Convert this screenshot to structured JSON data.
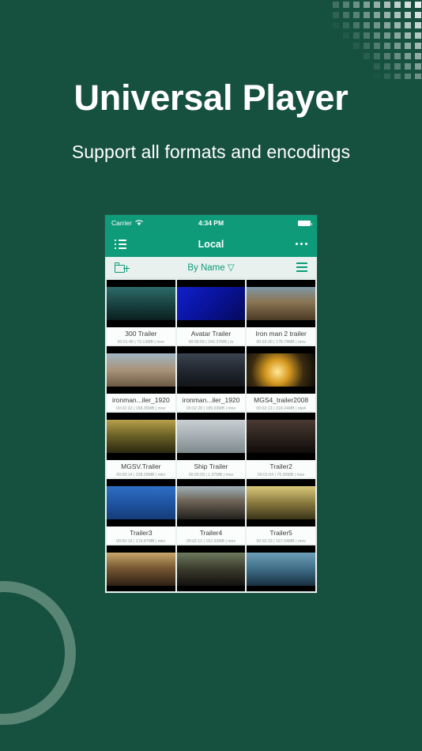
{
  "page": {
    "background_color": "#16503F",
    "accent_color": "#0D9B79",
    "ring_color": "#5D8878",
    "headline": "Universal Player",
    "subheadline": "Support all formats and encodings"
  },
  "decor": {
    "dot_grid_name": "dot-grid-decoration",
    "ring_name": "circle-outline-decoration"
  },
  "phone": {
    "status_bar": {
      "carrier": "Carrier",
      "wifi_icon": "wifi-icon",
      "time": "4:34 PM",
      "battery_icon": "battery-full-icon"
    },
    "nav_bar": {
      "left_icon": "list-view-icon",
      "title": "Local",
      "right_icon": "more-options-icon"
    },
    "toolbar": {
      "left_icon": "new-folder-icon",
      "sort_label": "By Name ▽",
      "right_icon": "hamburger-menu-icon"
    },
    "grid": {
      "items": [
        {
          "title": "300 Trailer",
          "meta": "00:01:46 | 73.13MB | mov",
          "art": "linear-gradient(180deg,#2d6b6a 0%,#18403f 55%,#0b1f20 100%)"
        },
        {
          "title": "Avatar Trailer",
          "meta": "00:00:59 | 242.37MB | ts",
          "art": "linear-gradient(135deg,#1020c8 0%,#0a14a0 45%,#050a5a 100%)"
        },
        {
          "title": "Iron man 2 trailer",
          "meta": "00:02:30 | 178.74MB | mov",
          "art": "linear-gradient(180deg,#7f98a8 0%,#8a7553 45%,#4a3a25 100%)"
        },
        {
          "title": "ironman...iler_1920",
          "meta": "00:02:32 | 158.35MB | mov",
          "art": "linear-gradient(180deg,#9fb6c4 0%,#a99379 50%,#6b5a44 100%)"
        },
        {
          "title": "ironman...iler_1920",
          "meta": "00:02:28 | 189.03MB | mov",
          "art": "linear-gradient(180deg,#3b4450 0%,#20262f 55%,#121519 100%)"
        },
        {
          "title": "MGS4_trailer2008",
          "meta": "00:02:13 | 318.24MB | mp4",
          "art": "radial-gradient(circle at 45% 55%,#ffe89a 0%,#d89a21 28%,#3b2c10 62%,#080806 100%)"
        },
        {
          "title": "MGSV.Trailer",
          "meta": "00:09:14 | 338.09MB | mkv",
          "art": "linear-gradient(180deg,#b7a04a 0%,#6f6428 45%,#2a2710 100%)"
        },
        {
          "title": "Ship Trailer",
          "meta": "00:00:09 | 1.97MB | mov",
          "art": "linear-gradient(180deg,#c9cfd2 0%,#a9b2b6 45%,#7e8a8d 100%)"
        },
        {
          "title": "Trailer2",
          "meta": "00:01:04 | 75.00MB | mov",
          "art": "linear-gradient(180deg,#4a3a33 0%,#2a211c 55%,#100c0a 100%)"
        },
        {
          "title": "Trailer3",
          "meta": "00:00:16 | 219.87MB | mkv",
          "art": "linear-gradient(180deg,#2f6fc4 0%,#1f55a3 50%,#143c78 100%)"
        },
        {
          "title": "Trailer4",
          "meta": "00:02:12 | 162.93MB | mov",
          "art": "linear-gradient(180deg,#9fb2b8 0%,#6e6356 45%,#22201d 100%)"
        },
        {
          "title": "Trailer5",
          "meta": "00:02:33 | 167.04MB | mov",
          "art": "linear-gradient(180deg,#d8c97a 0%,#8a7a3f 50%,#3a3418 100%)"
        }
      ],
      "partial_items": [
        {
          "art": "linear-gradient(180deg,#c9a66a 0%,#7a5a34 45%,#2e2014 100%)"
        },
        {
          "art": "linear-gradient(180deg,#6e7a5e 0%,#3a3a2c 50%,#121210 100%)"
        },
        {
          "art": "linear-gradient(180deg,#6f9fb8 0%,#3e6c86 50%,#18313f 100%)"
        }
      ]
    }
  }
}
